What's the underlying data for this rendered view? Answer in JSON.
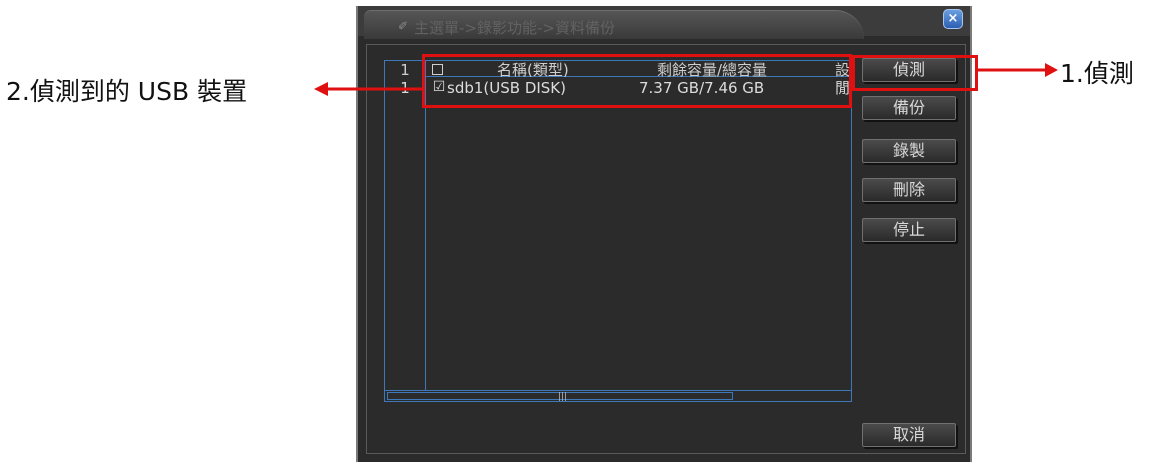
{
  "window": {
    "title": "主選單->錄影功能->資料備份",
    "close_label": "×"
  },
  "list": {
    "headers": {
      "index": "1",
      "name": "名稱(類型)",
      "capacity": "剩餘容量/總容量",
      "setting": "設"
    },
    "rows": [
      {
        "index": "1",
        "checkbox": "☑",
        "name": "sdb1(USB DISK)",
        "capacity": "7.37 GB/7.46 GB",
        "setting": "閒"
      }
    ],
    "scroll_grip": "|||"
  },
  "buttons": {
    "detect": "偵測",
    "backup": "備份",
    "record": "錄製",
    "delete": "刪除",
    "stop": "停止",
    "cancel": "取消"
  },
  "annotations": {
    "detect_label": "1.偵測",
    "device_label": "2.偵測到的 USB 裝置"
  },
  "colors": {
    "highlight": "#e01010",
    "list_border": "#3f78b8",
    "panel_bg": "#2b2b2b"
  }
}
